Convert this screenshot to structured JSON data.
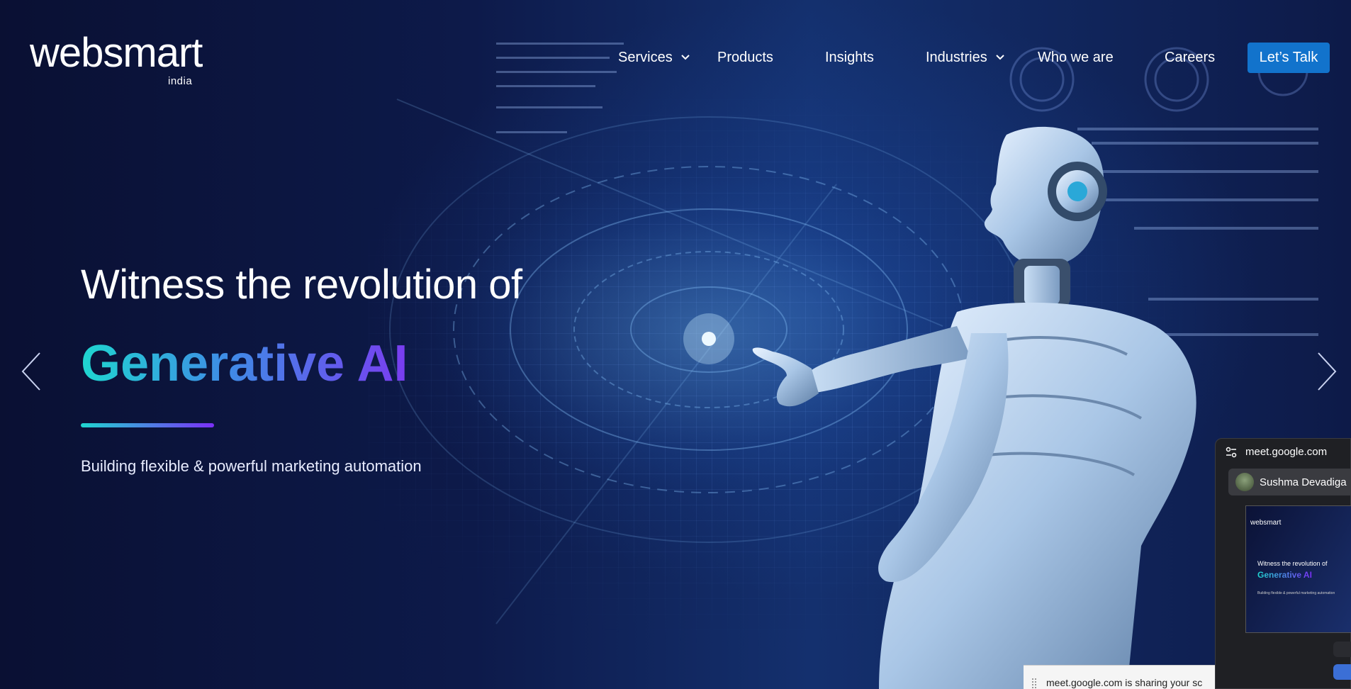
{
  "header": {
    "logo_text": "websmart",
    "logo_sub": "india",
    "nav": [
      {
        "label": "Services",
        "has_dropdown": true
      },
      {
        "label": "Products",
        "has_dropdown": false
      },
      {
        "label": "Insights",
        "has_dropdown": false
      },
      {
        "label": "Industries",
        "has_dropdown": true
      },
      {
        "label": "Who we are",
        "has_dropdown": false
      },
      {
        "label": "Careers",
        "has_dropdown": false
      }
    ],
    "cta_label": "Let’s Talk"
  },
  "hero": {
    "headline": "Witness the revolution of",
    "highlight": "Generative AI",
    "subtext": "Building flexible & powerful marketing automation",
    "prev_icon": "chevron-left-icon",
    "next_icon": "chevron-right-icon"
  },
  "meet_popup": {
    "url": "meet.google.com",
    "participant": "Sushma Devadiga",
    "preview": {
      "logo": "websmart",
      "line1": "Witness the revolution of",
      "line2": "Generative AI",
      "line3": "Building flexible & powerful marketing automation"
    },
    "share_notice": "meet.google.com is sharing your sc"
  },
  "colors": {
    "background": "#0b1236",
    "cta": "#1273cc",
    "gradient_start": "#1fd6d0",
    "gradient_end": "#7b2ff7"
  }
}
